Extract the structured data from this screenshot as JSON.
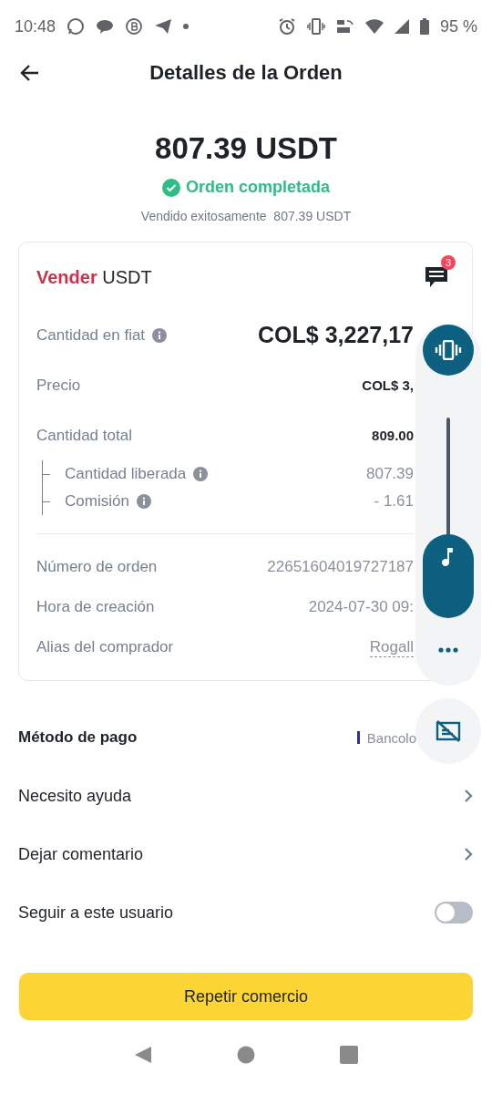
{
  "status_bar": {
    "time": "10:48",
    "battery": "95 %"
  },
  "header": {
    "title": "Detalles de la Orden"
  },
  "summary": {
    "amount": "807.39 USDT",
    "status": "Orden completada",
    "subtitle": "Vendido exitosamente  807.39 USDT"
  },
  "card": {
    "side": "Vender",
    "asset": "USDT",
    "chat_badge": "3",
    "amount_rows": [
      {
        "kind": "large",
        "label": "Cantidad en fiat",
        "info": true,
        "value": "COL$ 3,227,17"
      },
      {
        "kind": "bold",
        "label": "Precio",
        "info": false,
        "value": "COL$ 3,"
      },
      {
        "kind": "bold",
        "label": "Cantidad total",
        "info": false,
        "value": "809.00",
        "children": [
          {
            "label": "Cantidad liberada",
            "info": true,
            "value": "807.39"
          },
          {
            "label": "Comisión",
            "info": true,
            "value": "- 1.61"
          }
        ]
      }
    ],
    "order_rows": [
      {
        "kind": "plain",
        "label": "Número de orden",
        "info": false,
        "value": "22651604019727187"
      },
      {
        "kind": "plain",
        "label": "Hora de creación",
        "info": false,
        "value": "2024-07-30 09:"
      },
      {
        "kind": "alias",
        "label": "Alias del comprador",
        "info": false,
        "value": "Rogall"
      }
    ]
  },
  "options": [
    {
      "kind": "value",
      "label": "Método de pago",
      "value": "Bancolo",
      "color": "#2b3486"
    },
    {
      "kind": "link",
      "label": "Necesito ayuda"
    },
    {
      "kind": "link",
      "label": "Dejar comentario"
    },
    {
      "kind": "toggle",
      "label": "Seguir a este usuario",
      "on": false
    }
  ],
  "primary_button": "Repetir comercio",
  "volume_panel": {
    "level": 0.42
  }
}
